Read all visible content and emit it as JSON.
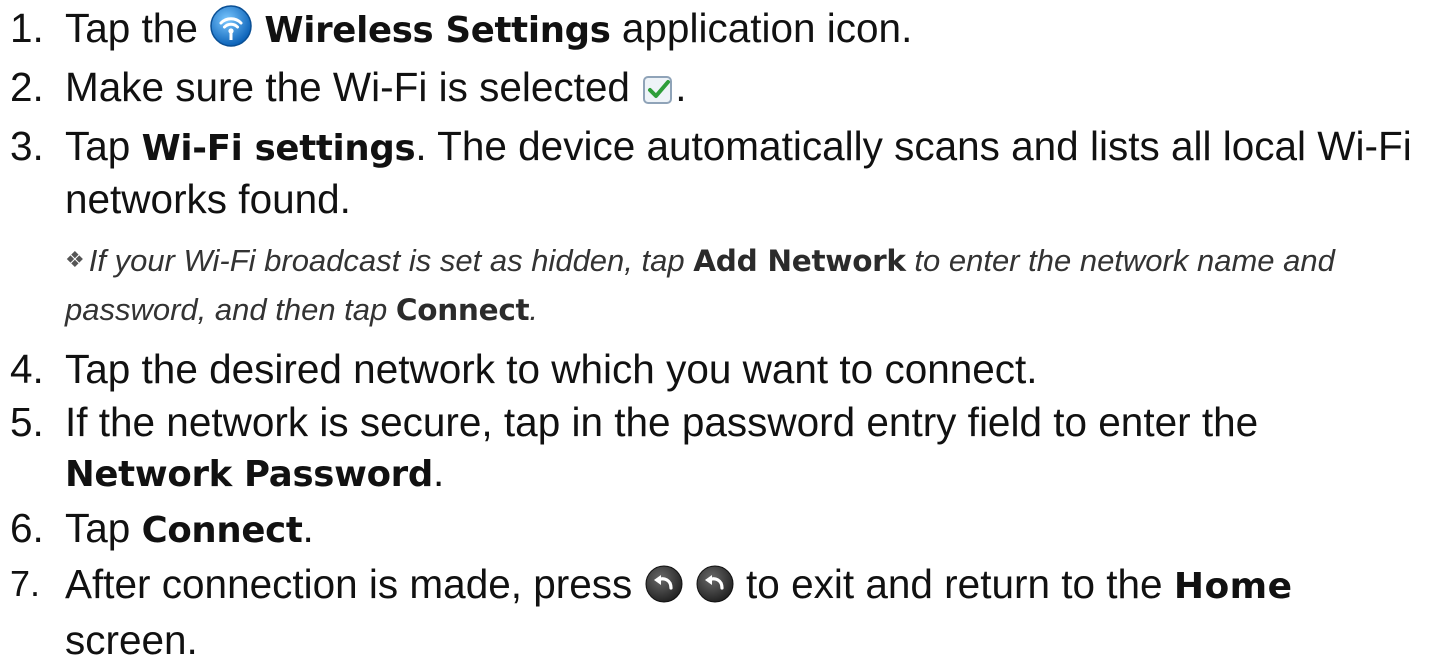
{
  "steps": [
    {
      "num": "1.",
      "before": "Tap the ",
      "icon": "wireless-settings-icon",
      "bold": "Wireless Settings",
      "after": " application icon."
    },
    {
      "num": "2.",
      "before": "Make sure the Wi-Fi is selected ",
      "icon": "checkbox-checked-icon",
      "after": "."
    },
    {
      "num": "3.",
      "before": "Tap ",
      "bold": "Wi-Fi settings",
      "after": ". The device automatically scans and lists all local Wi-Fi networks found."
    },
    {
      "num": "4.",
      "text": "Tap the desired network to which you want to connect."
    },
    {
      "num": "5.",
      "before": "If the network is secure, tap in the password entry field to enter the ",
      "bold": "Network Password",
      "after": "."
    },
    {
      "num": "6.",
      "before": "Tap ",
      "bold": "Connect",
      "after": "."
    },
    {
      "num": "7.",
      "before": "After connection is made, press ",
      "icons": [
        "back-icon",
        "back-icon"
      ],
      "middle": " to exit and return to the ",
      "bold": "Home",
      "after": " screen."
    }
  ],
  "note": {
    "bullet": "❖",
    "part1": "If your Wi-Fi broadcast is set as hidden, tap ",
    "bold1": "Add Network",
    "part2": " to enter the network name and password, and then tap ",
    "bold2": "Connect",
    "part3": "."
  },
  "colors": {
    "wifi_icon": "#1e88d8",
    "checkbox_tick": "#2e9e3a",
    "back_icon": "#3a3a3a"
  }
}
